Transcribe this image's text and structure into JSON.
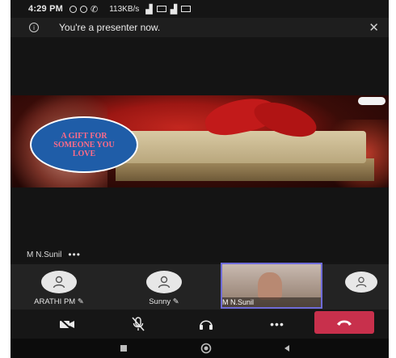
{
  "statusbar": {
    "time": "4:29 PM",
    "network_speed": "113KB/s"
  },
  "banner": {
    "message": "You're a presenter now.",
    "close_glyph": "✕"
  },
  "slide": {
    "badge_text": "A GIFT FOR SOMEONE YOU LOVE"
  },
  "presenter": {
    "name": "M N.Sunil",
    "more_label": "•••"
  },
  "participants": [
    {
      "name": "ARATHI PM",
      "icon": "mic-off-icon"
    },
    {
      "name": "Sunny",
      "icon": "mic-off-icon"
    },
    {
      "name": "M N.Sunil",
      "icon": "video-tile"
    },
    {
      "name": "",
      "icon": "avatar"
    }
  ],
  "callbar": {
    "buttons": [
      "video-off-icon",
      "mic-off-icon",
      "headphones-icon",
      "more-icon",
      "hang-up-icon"
    ],
    "more_label": "•••",
    "hangup_color": "#c8304c"
  },
  "navbar": {
    "buttons": [
      "recents-icon",
      "home-icon",
      "back-icon"
    ]
  },
  "colors": {
    "active_tile_border": "#6e6bd8",
    "badge_bg": "#1f5da8",
    "badge_text": "#ff6b88"
  }
}
